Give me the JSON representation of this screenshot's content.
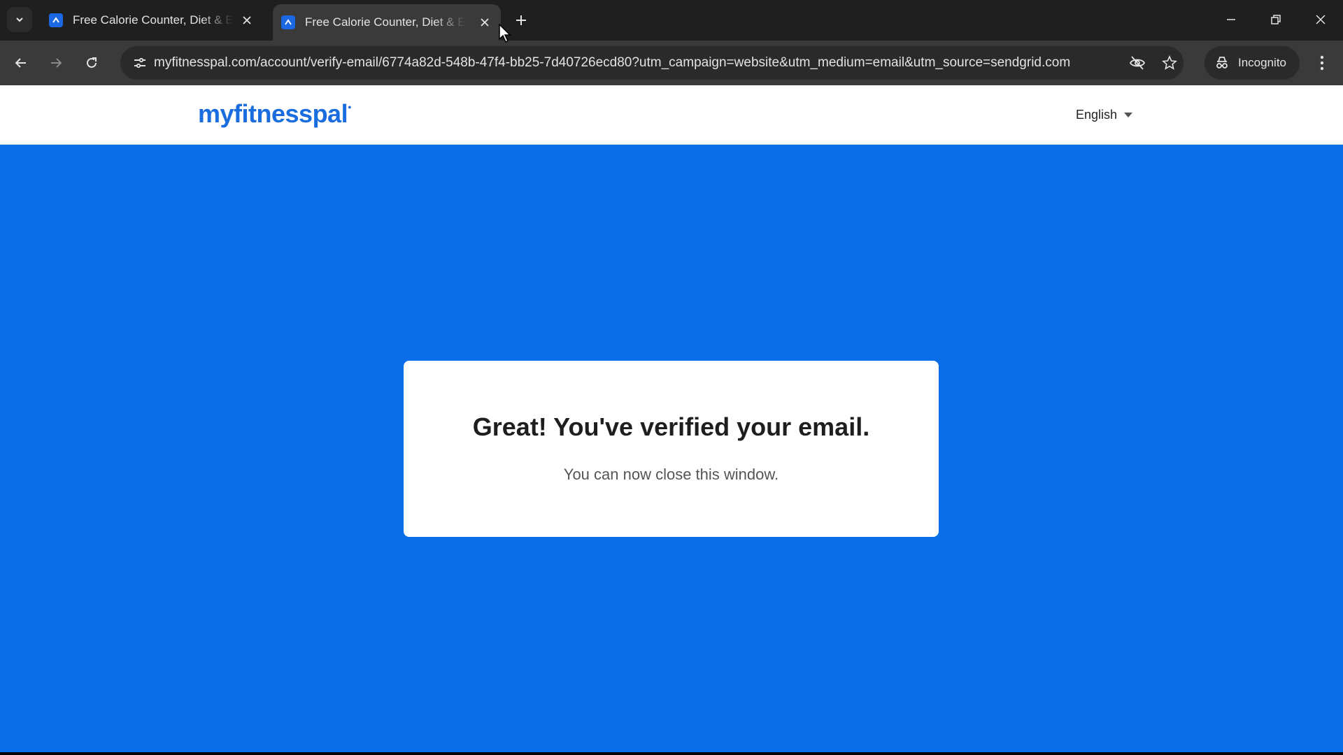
{
  "tabs": [
    {
      "title": "Free Calorie Counter, Diet & Exercise Journal | MyFitnessPal.com",
      "active": false
    },
    {
      "title": "Free Calorie Counter, Diet & Exercise Journal | MyFitnessPal.com",
      "active": true
    }
  ],
  "toolbar": {
    "url": "myfitnesspal.com/account/verify-email/6774a82d-548b-47f4-bb25-7d40726ecd80?utm_campaign=website&utm_medium=email&utm_source=sendgrid.com",
    "incognito_label": "Incognito"
  },
  "page": {
    "logo": "myfitnesspal",
    "language": "English",
    "heading": "Great! You've verified your email.",
    "message": "You can now close this window."
  },
  "colors": {
    "page_background": "#0b6ee8",
    "brand": "#1a6dde",
    "tabstrip": "#1f1f1f",
    "toolbar": "#3a3a3a"
  },
  "icons": [
    "tab-search-icon",
    "favicon-icon",
    "close-icon",
    "plus-icon",
    "minimize-icon",
    "restore-icon",
    "window-close-icon",
    "back-icon",
    "forward-icon",
    "reload-icon",
    "site-info-icon",
    "eye-off-icon",
    "star-icon",
    "incognito-icon",
    "more-vert-icon",
    "chevron-down-icon"
  ]
}
